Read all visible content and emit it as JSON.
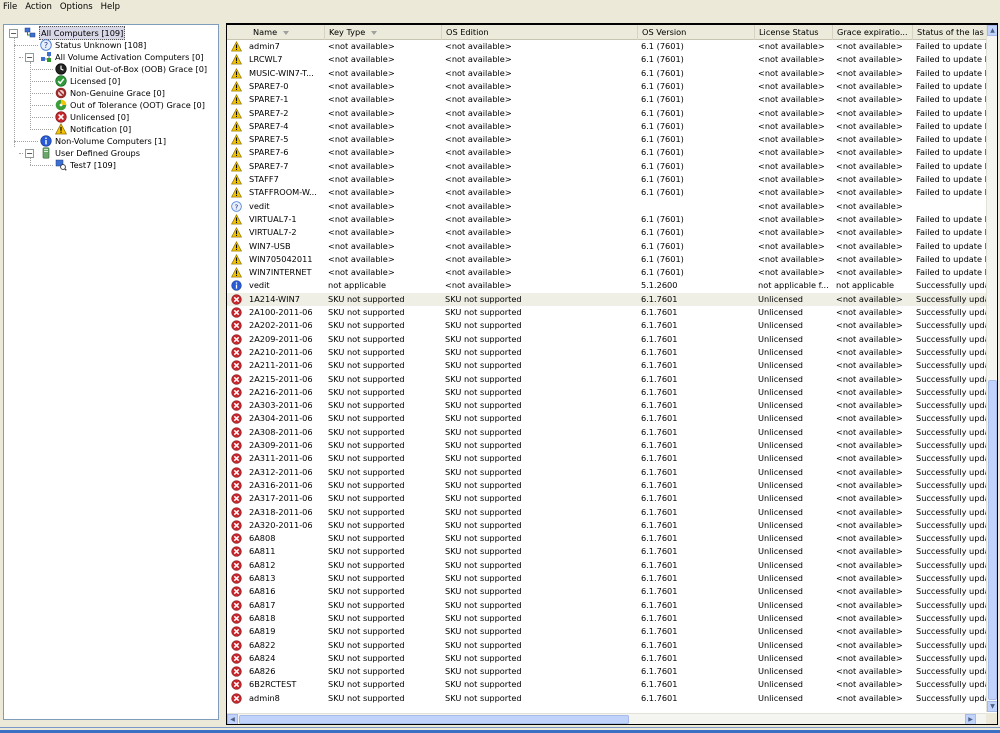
{
  "menu": [
    "File",
    "Action",
    "Options",
    "Help"
  ],
  "tree": [
    {
      "label": "All Computers [109]",
      "icon": "computers-network-icon",
      "selected": true
    },
    {
      "label": "Status Unknown [108]",
      "icon": "question-icon"
    },
    {
      "label": "All Volume Activation Computers [0]",
      "icon": "volume-network-icon"
    },
    {
      "label": "Initial Out-of-Box (OOB) Grace [0]",
      "icon": "clock-icon"
    },
    {
      "label": "Licensed [0]",
      "icon": "check-icon"
    },
    {
      "label": "Non-Genuine Grace [0]",
      "icon": "non-genuine-icon"
    },
    {
      "label": "Out of Tolerance (OOT) Grace [0]",
      "icon": "oot-icon"
    },
    {
      "label": "Unlicensed [0]",
      "icon": "error-icon"
    },
    {
      "label": "Notification [0]",
      "icon": "warning-icon"
    },
    {
      "label": "Non-Volume Computers [1]",
      "icon": "info-icon"
    },
    {
      "label": "User Defined Groups",
      "icon": "group-icon"
    },
    {
      "label": "Test7 [109]",
      "icon": "search-group-icon"
    }
  ],
  "columns": [
    "Name",
    "Key Type",
    "OS Edition",
    "OS Version",
    "License Status",
    "Grace expiratio...",
    "Status of the las"
  ],
  "rows": [
    {
      "icon": "warning",
      "name": "admin7",
      "key": "<not available>",
      "edition": "<not available>",
      "version": "6.1 (7601)",
      "license": "<not available>",
      "grace": "<not available>",
      "status": "Failed to update I"
    },
    {
      "icon": "warning",
      "name": "LRCWL7",
      "key": "<not available>",
      "edition": "<not available>",
      "version": "6.1 (7601)",
      "license": "<not available>",
      "grace": "<not available>",
      "status": "Failed to update I"
    },
    {
      "icon": "warning",
      "name": "MUSIC-WIN7-T...",
      "key": "<not available>",
      "edition": "<not available>",
      "version": "6.1 (7601)",
      "license": "<not available>",
      "grace": "<not available>",
      "status": "Failed to update I"
    },
    {
      "icon": "warning",
      "name": "SPARE7-0",
      "key": "<not available>",
      "edition": "<not available>",
      "version": "6.1 (7601)",
      "license": "<not available>",
      "grace": "<not available>",
      "status": "Failed to update I"
    },
    {
      "icon": "warning",
      "name": "SPARE7-1",
      "key": "<not available>",
      "edition": "<not available>",
      "version": "6.1 (7601)",
      "license": "<not available>",
      "grace": "<not available>",
      "status": "Failed to update I"
    },
    {
      "icon": "warning",
      "name": "SPARE7-2",
      "key": "<not available>",
      "edition": "<not available>",
      "version": "6.1 (7601)",
      "license": "<not available>",
      "grace": "<not available>",
      "status": "Failed to update I"
    },
    {
      "icon": "warning",
      "name": "SPARE7-4",
      "key": "<not available>",
      "edition": "<not available>",
      "version": "6.1 (7601)",
      "license": "<not available>",
      "grace": "<not available>",
      "status": "Failed to update I"
    },
    {
      "icon": "warning",
      "name": "SPARE7-5",
      "key": "<not available>",
      "edition": "<not available>",
      "version": "6.1 (7601)",
      "license": "<not available>",
      "grace": "<not available>",
      "status": "Failed to update I"
    },
    {
      "icon": "warning",
      "name": "SPARE7-6",
      "key": "<not available>",
      "edition": "<not available>",
      "version": "6.1 (7601)",
      "license": "<not available>",
      "grace": "<not available>",
      "status": "Failed to update I"
    },
    {
      "icon": "warning",
      "name": "SPARE7-7",
      "key": "<not available>",
      "edition": "<not available>",
      "version": "6.1 (7601)",
      "license": "<not available>",
      "grace": "<not available>",
      "status": "Failed to update I"
    },
    {
      "icon": "warning",
      "name": "STAFF7",
      "key": "<not available>",
      "edition": "<not available>",
      "version": "6.1 (7601)",
      "license": "<not available>",
      "grace": "<not available>",
      "status": "Failed to update I"
    },
    {
      "icon": "warning",
      "name": "STAFFROOM-W...",
      "key": "<not available>",
      "edition": "<not available>",
      "version": "6.1 (7601)",
      "license": "<not available>",
      "grace": "<not available>",
      "status": "Failed to update I"
    },
    {
      "icon": "question",
      "name": "vedit",
      "key": "<not available>",
      "edition": "<not available>",
      "version": "",
      "license": "<not available>",
      "grace": "<not available>",
      "status": ""
    },
    {
      "icon": "warning",
      "name": "VIRTUAL7-1",
      "key": "<not available>",
      "edition": "<not available>",
      "version": "6.1 (7601)",
      "license": "<not available>",
      "grace": "<not available>",
      "status": "Failed to update I"
    },
    {
      "icon": "warning",
      "name": "VIRTUAL7-2",
      "key": "<not available>",
      "edition": "<not available>",
      "version": "6.1 (7601)",
      "license": "<not available>",
      "grace": "<not available>",
      "status": "Failed to update I"
    },
    {
      "icon": "warning",
      "name": "WIN7-USB",
      "key": "<not available>",
      "edition": "<not available>",
      "version": "6.1 (7601)",
      "license": "<not available>",
      "grace": "<not available>",
      "status": "Failed to update I"
    },
    {
      "icon": "warning",
      "name": "WIN705042011",
      "key": "<not available>",
      "edition": "<not available>",
      "version": "6.1 (7601)",
      "license": "<not available>",
      "grace": "<not available>",
      "status": "Failed to update I"
    },
    {
      "icon": "warning",
      "name": "WIN7INTERNET",
      "key": "<not available>",
      "edition": "<not available>",
      "version": "6.1 (7601)",
      "license": "<not available>",
      "grace": "<not available>",
      "status": "Failed to update I"
    },
    {
      "icon": "info",
      "name": "vedit",
      "key": "not applicable",
      "edition": "<not available>",
      "version": "5.1.2600",
      "license": "not applicable f...",
      "grace": "not applicable",
      "status": "Successfully upda"
    },
    {
      "icon": "error",
      "name": "1A214-WIN7",
      "key": "SKU not supported",
      "edition": "SKU not supported",
      "version": "6.1.7601",
      "license": "Unlicensed",
      "grace": "<not available>",
      "status": "Successfully upda",
      "highlight": true
    },
    {
      "icon": "error",
      "name": "2A100-2011-06",
      "key": "SKU not supported",
      "edition": "SKU not supported",
      "version": "6.1.7601",
      "license": "Unlicensed",
      "grace": "<not available>",
      "status": "Successfully upda"
    },
    {
      "icon": "error",
      "name": "2A202-2011-06",
      "key": "SKU not supported",
      "edition": "SKU not supported",
      "version": "6.1.7601",
      "license": "Unlicensed",
      "grace": "<not available>",
      "status": "Successfully upda"
    },
    {
      "icon": "error",
      "name": "2A209-2011-06",
      "key": "SKU not supported",
      "edition": "SKU not supported",
      "version": "6.1.7601",
      "license": "Unlicensed",
      "grace": "<not available>",
      "status": "Successfully upda"
    },
    {
      "icon": "error",
      "name": "2A210-2011-06",
      "key": "SKU not supported",
      "edition": "SKU not supported",
      "version": "6.1.7601",
      "license": "Unlicensed",
      "grace": "<not available>",
      "status": "Successfully upda"
    },
    {
      "icon": "error",
      "name": "2A211-2011-06",
      "key": "SKU not supported",
      "edition": "SKU not supported",
      "version": "6.1.7601",
      "license": "Unlicensed",
      "grace": "<not available>",
      "status": "Successfully upda"
    },
    {
      "icon": "error",
      "name": "2A215-2011-06",
      "key": "SKU not supported",
      "edition": "SKU not supported",
      "version": "6.1.7601",
      "license": "Unlicensed",
      "grace": "<not available>",
      "status": "Successfully upda"
    },
    {
      "icon": "error",
      "name": "2A216-2011-06",
      "key": "SKU not supported",
      "edition": "SKU not supported",
      "version": "6.1.7601",
      "license": "Unlicensed",
      "grace": "<not available>",
      "status": "Successfully upda"
    },
    {
      "icon": "error",
      "name": "2A303-2011-06",
      "key": "SKU not supported",
      "edition": "SKU not supported",
      "version": "6.1.7601",
      "license": "Unlicensed",
      "grace": "<not available>",
      "status": "Successfully upda"
    },
    {
      "icon": "error",
      "name": "2A304-2011-06",
      "key": "SKU not supported",
      "edition": "SKU not supported",
      "version": "6.1.7601",
      "license": "Unlicensed",
      "grace": "<not available>",
      "status": "Successfully upda"
    },
    {
      "icon": "error",
      "name": "2A308-2011-06",
      "key": "SKU not supported",
      "edition": "SKU not supported",
      "version": "6.1.7601",
      "license": "Unlicensed",
      "grace": "<not available>",
      "status": "Successfully upda"
    },
    {
      "icon": "error",
      "name": "2A309-2011-06",
      "key": "SKU not supported",
      "edition": "SKU not supported",
      "version": "6.1.7601",
      "license": "Unlicensed",
      "grace": "<not available>",
      "status": "Successfully upda"
    },
    {
      "icon": "error",
      "name": "2A311-2011-06",
      "key": "SKU not supported",
      "edition": "SKU not supported",
      "version": "6.1.7601",
      "license": "Unlicensed",
      "grace": "<not available>",
      "status": "Successfully upda"
    },
    {
      "icon": "error",
      "name": "2A312-2011-06",
      "key": "SKU not supported",
      "edition": "SKU not supported",
      "version": "6.1.7601",
      "license": "Unlicensed",
      "grace": "<not available>",
      "status": "Successfully upda"
    },
    {
      "icon": "error",
      "name": "2A316-2011-06",
      "key": "SKU not supported",
      "edition": "SKU not supported",
      "version": "6.1.7601",
      "license": "Unlicensed",
      "grace": "<not available>",
      "status": "Successfully upda"
    },
    {
      "icon": "error",
      "name": "2A317-2011-06",
      "key": "SKU not supported",
      "edition": "SKU not supported",
      "version": "6.1.7601",
      "license": "Unlicensed",
      "grace": "<not available>",
      "status": "Successfully upda"
    },
    {
      "icon": "error",
      "name": "2A318-2011-06",
      "key": "SKU not supported",
      "edition": "SKU not supported",
      "version": "6.1.7601",
      "license": "Unlicensed",
      "grace": "<not available>",
      "status": "Successfully upda"
    },
    {
      "icon": "error",
      "name": "2A320-2011-06",
      "key": "SKU not supported",
      "edition": "SKU not supported",
      "version": "6.1.7601",
      "license": "Unlicensed",
      "grace": "<not available>",
      "status": "Successfully upda"
    },
    {
      "icon": "error",
      "name": "6A808",
      "key": "SKU not supported",
      "edition": "SKU not supported",
      "version": "6.1.7601",
      "license": "Unlicensed",
      "grace": "<not available>",
      "status": "Successfully upda"
    },
    {
      "icon": "error",
      "name": "6A811",
      "key": "SKU not supported",
      "edition": "SKU not supported",
      "version": "6.1.7601",
      "license": "Unlicensed",
      "grace": "<not available>",
      "status": "Successfully upda"
    },
    {
      "icon": "error",
      "name": "6A812",
      "key": "SKU not supported",
      "edition": "SKU not supported",
      "version": "6.1.7601",
      "license": "Unlicensed",
      "grace": "<not available>",
      "status": "Successfully upda"
    },
    {
      "icon": "error",
      "name": "6A813",
      "key": "SKU not supported",
      "edition": "SKU not supported",
      "version": "6.1.7601",
      "license": "Unlicensed",
      "grace": "<not available>",
      "status": "Successfully upda"
    },
    {
      "icon": "error",
      "name": "6A816",
      "key": "SKU not supported",
      "edition": "SKU not supported",
      "version": "6.1.7601",
      "license": "Unlicensed",
      "grace": "<not available>",
      "status": "Successfully upda"
    },
    {
      "icon": "error",
      "name": "6A817",
      "key": "SKU not supported",
      "edition": "SKU not supported",
      "version": "6.1.7601",
      "license": "Unlicensed",
      "grace": "<not available>",
      "status": "Successfully upda"
    },
    {
      "icon": "error",
      "name": "6A818",
      "key": "SKU not supported",
      "edition": "SKU not supported",
      "version": "6.1.7601",
      "license": "Unlicensed",
      "grace": "<not available>",
      "status": "Successfully upda"
    },
    {
      "icon": "error",
      "name": "6A819",
      "key": "SKU not supported",
      "edition": "SKU not supported",
      "version": "6.1.7601",
      "license": "Unlicensed",
      "grace": "<not available>",
      "status": "Successfully upda"
    },
    {
      "icon": "error",
      "name": "6A822",
      "key": "SKU not supported",
      "edition": "SKU not supported",
      "version": "6.1.7601",
      "license": "Unlicensed",
      "grace": "<not available>",
      "status": "Successfully upda"
    },
    {
      "icon": "error",
      "name": "6A824",
      "key": "SKU not supported",
      "edition": "SKU not supported",
      "version": "6.1.7601",
      "license": "Unlicensed",
      "grace": "<not available>",
      "status": "Successfully upda"
    },
    {
      "icon": "error",
      "name": "6A826",
      "key": "SKU not supported",
      "edition": "SKU not supported",
      "version": "6.1.7601",
      "license": "Unlicensed",
      "grace": "<not available>",
      "status": "Successfully upda"
    },
    {
      "icon": "error",
      "name": "6B2RCTEST",
      "key": "SKU not supported",
      "edition": "SKU not supported",
      "version": "6.1.7601",
      "license": "Unlicensed",
      "grace": "<not available>",
      "status": "Successfully upda"
    },
    {
      "icon": "error",
      "name": "admin8",
      "key": "SKU not supported",
      "edition": "SKU not supported",
      "version": "6.1.7601",
      "license": "Unlicensed",
      "grace": "<not available>",
      "status": "Successfully upda"
    }
  ],
  "colors": {
    "warning": "#f5c400",
    "error": "#c8262c",
    "info": "#2a5bd7",
    "question": "#4a7fd6",
    "accent": "#3b6fc4"
  }
}
